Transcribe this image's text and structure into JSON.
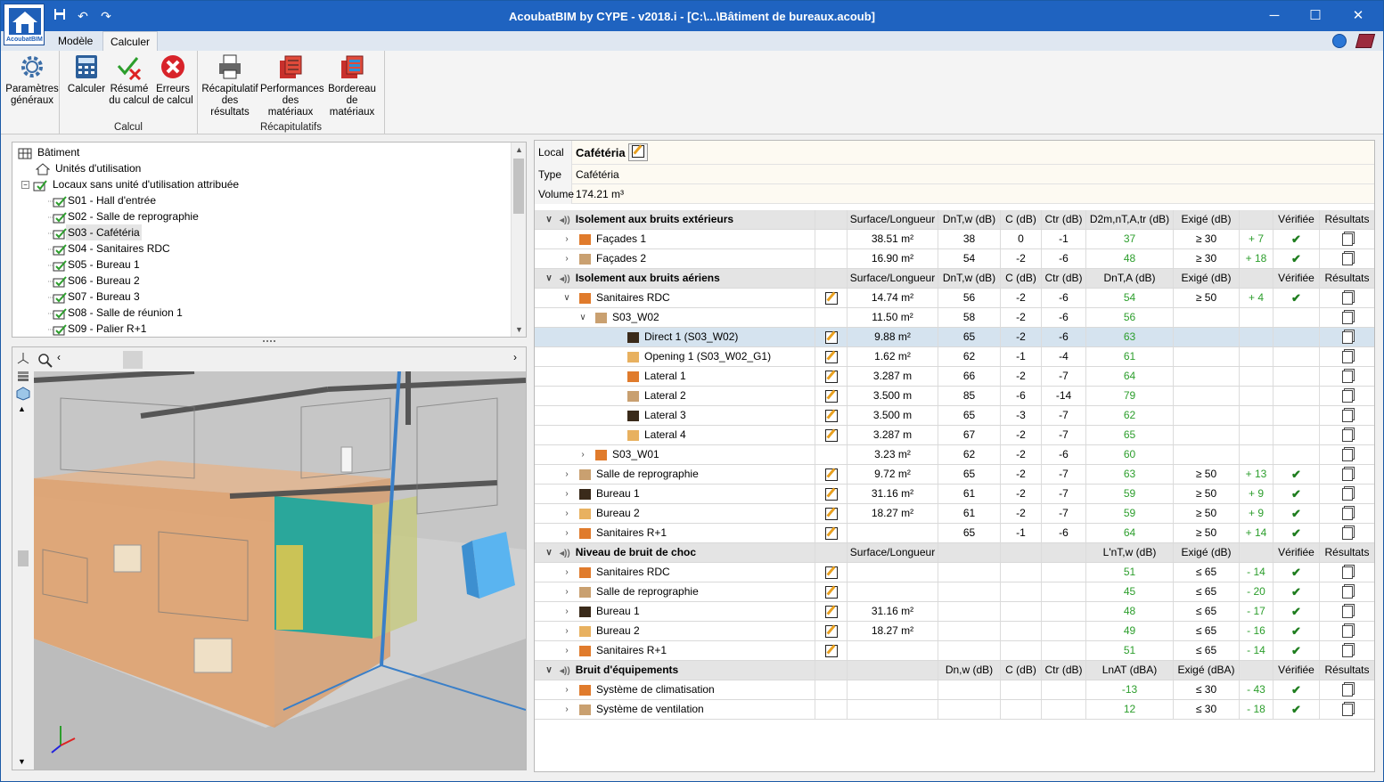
{
  "window": {
    "title": "AcoubatBIM by CYPE - v2018.i - [C:\\...\\Bâtiment de bureaux.acoub]",
    "logo_text": "AcoubatBIM"
  },
  "tabs": [
    {
      "label": "Modèle"
    },
    {
      "label": "Calculer"
    }
  ],
  "ribbon": {
    "buttons": [
      {
        "label1": "Paramètres",
        "label2": "généraux"
      },
      {
        "label1": "Calculer",
        "label2": ""
      },
      {
        "label1": "Résumé",
        "label2": "du calcul"
      },
      {
        "label1": "Erreurs",
        "label2": "de calcul"
      },
      {
        "label1": "Récapitulatif",
        "label2": "des résultats"
      },
      {
        "label1": "Performances",
        "label2": "des matériaux"
      },
      {
        "label1": "Bordereau",
        "label2": "de matériaux"
      }
    ],
    "groups": [
      {
        "label": "Calcul"
      },
      {
        "label": "Récapitulatifs"
      }
    ]
  },
  "tree": {
    "items": [
      {
        "label": "Bâtiment"
      },
      {
        "label": "Unités d'utilisation"
      },
      {
        "label": "Locaux sans unité d'utilisation attribuée"
      },
      {
        "label": "S01 - Hall d'entrée"
      },
      {
        "label": "S02 - Salle de reprographie"
      },
      {
        "label": "S03 - Cafétéria"
      },
      {
        "label": "S04 - Sanitaires RDC"
      },
      {
        "label": "S05 - Bureau 1"
      },
      {
        "label": "S06 - Bureau 2"
      },
      {
        "label": "S07 - Bureau 3"
      },
      {
        "label": "S08 - Salle de réunion 1"
      },
      {
        "label": "S09 - Palier R+1"
      }
    ]
  },
  "props": {
    "local_label": "Local",
    "local_value": "Cafétéria",
    "type_label": "Type",
    "type_value": "Cafétéria",
    "volume_label": "Volume",
    "volume_value": "174.21  m³"
  },
  "sections": [
    {
      "title": "Isolement aux bruits extérieurs",
      "headers": [
        "Surface/Longueur",
        "DnT,w (dB)",
        "C (dB)",
        "Ctr (dB)",
        "D2m,nT,A,tr (dB)",
        "Exigé (dB)",
        "",
        "Vérifiée",
        "Résultats"
      ],
      "rows": [
        {
          "name": "Façades 1",
          "cells": [
            "38.51 m²",
            "38",
            "0",
            "-1",
            "37",
            "≥ 30",
            "+ 7"
          ],
          "check": true
        },
        {
          "name": "Façades 2",
          "cells": [
            "16.90 m²",
            "54",
            "-2",
            "-6",
            "48",
            "≥ 30",
            "+ 18"
          ],
          "check": true
        }
      ]
    },
    {
      "title": "Isolement aux bruits aériens",
      "headers": [
        "Surface/Longueur",
        "DnT,w (dB)",
        "C (dB)",
        "Ctr (dB)",
        "DnT,A (dB)",
        "Exigé (dB)",
        "",
        "Vérifiée",
        "Résultats"
      ],
      "rows": [
        {
          "name": "Sanitaires RDC",
          "cells": [
            "14.74 m²",
            "56",
            "-2",
            "-6",
            "54",
            "≥ 50",
            "+ 4"
          ],
          "check": true
        },
        {
          "name": "S03_W02",
          "cells": [
            "11.50 m²",
            "58",
            "-2",
            "-6",
            "56",
            "",
            ""
          ],
          "check": false
        },
        {
          "name": "Direct 1 (S03_W02)",
          "cells": [
            "9.88 m²",
            "65",
            "-2",
            "-6",
            "63",
            "",
            ""
          ],
          "check": false
        },
        {
          "name": "Opening 1 (S03_W02_G1)",
          "cells": [
            "1.62 m²",
            "62",
            "-1",
            "-4",
            "61",
            "",
            ""
          ],
          "check": false
        },
        {
          "name": "Lateral 1",
          "cells": [
            "3.287 m",
            "66",
            "-2",
            "-7",
            "64",
            "",
            ""
          ],
          "check": false
        },
        {
          "name": "Lateral 2",
          "cells": [
            "3.500 m",
            "85",
            "-6",
            "-14",
            "79",
            "",
            ""
          ],
          "check": false
        },
        {
          "name": "Lateral 3",
          "cells": [
            "3.500 m",
            "65",
            "-3",
            "-7",
            "62",
            "",
            ""
          ],
          "check": false
        },
        {
          "name": "Lateral 4",
          "cells": [
            "3.287 m",
            "67",
            "-2",
            "-7",
            "65",
            "",
            ""
          ],
          "check": false
        },
        {
          "name": "S03_W01",
          "cells": [
            "3.23 m²",
            "62",
            "-2",
            "-6",
            "60",
            "",
            ""
          ],
          "check": false
        },
        {
          "name": "Salle de reprographie",
          "cells": [
            "9.72 m²",
            "65",
            "-2",
            "-7",
            "63",
            "≥ 50",
            "+ 13"
          ],
          "check": true
        },
        {
          "name": "Bureau 1",
          "cells": [
            "31.16 m²",
            "61",
            "-2",
            "-7",
            "59",
            "≥ 50",
            "+ 9"
          ],
          "check": true
        },
        {
          "name": "Bureau 2",
          "cells": [
            "18.27 m²",
            "61",
            "-2",
            "-7",
            "59",
            "≥ 50",
            "+ 9"
          ],
          "check": true
        },
        {
          "name": "Sanitaires R+1",
          "cells": [
            "",
            "65",
            "-1",
            "-6",
            "64",
            "≥ 50",
            "+ 14"
          ],
          "check": true
        }
      ]
    },
    {
      "title": "Niveau de bruit de choc",
      "headers": [
        "Surface/Longueur",
        "",
        "",
        "",
        "L'nT,w (dB)",
        "Exigé (dB)",
        "",
        "Vérifiée",
        "Résultats"
      ],
      "rows": [
        {
          "name": "Sanitaires RDC",
          "cells": [
            "",
            "",
            "",
            "",
            "51",
            "≤ 65",
            "- 14"
          ],
          "check": true
        },
        {
          "name": "Salle de reprographie",
          "cells": [
            "",
            "",
            "",
            "",
            "45",
            "≤ 65",
            "- 20"
          ],
          "check": true
        },
        {
          "name": "Bureau 1",
          "cells": [
            "31.16 m²",
            "",
            "",
            "",
            "48",
            "≤ 65",
            "- 17"
          ],
          "check": true
        },
        {
          "name": "Bureau 2",
          "cells": [
            "18.27 m²",
            "",
            "",
            "",
            "49",
            "≤ 65",
            "- 16"
          ],
          "check": true
        },
        {
          "name": "Sanitaires R+1",
          "cells": [
            "",
            "",
            "",
            "",
            "51",
            "≤ 65",
            "- 14"
          ],
          "check": true
        }
      ]
    },
    {
      "title": "Bruit d'équipements",
      "headers": [
        "",
        "Dn,w (dB)",
        "C (dB)",
        "Ctr (dB)",
        "LnAT (dBA)",
        "Exigé (dBA)",
        "",
        "Vérifiée",
        "Résultats"
      ],
      "rows": [
        {
          "name": "Système de climatisation",
          "cells": [
            "",
            "",
            "",
            "",
            "-13",
            "≤ 30",
            "- 43"
          ],
          "check": true
        },
        {
          "name": "Système de ventilation",
          "cells": [
            "",
            "",
            "",
            "",
            "12",
            "≤ 30",
            "- 18"
          ],
          "check": true
        }
      ]
    }
  ],
  "colors": {
    "titlebar": "#1f63c0",
    "green_value": "#2c9e2c",
    "highlight_row": "#d5e3ef",
    "wall_orange": "#e08a3a"
  }
}
